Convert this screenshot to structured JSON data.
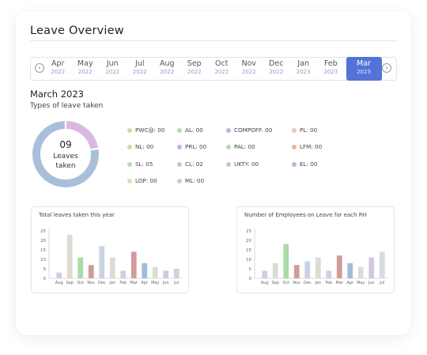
{
  "page": {
    "title": "Leave Overview"
  },
  "month_nav": {
    "prev_icon": "chevron-left-icon",
    "next_icon": "chevron-right-icon",
    "months": [
      {
        "month": "Apr",
        "year": "2022"
      },
      {
        "month": "May",
        "year": "2022"
      },
      {
        "month": "Jun",
        "year": "2022"
      },
      {
        "month": "Jul",
        "year": "2022"
      },
      {
        "month": "Aug",
        "year": "2022"
      },
      {
        "month": "Sep",
        "year": "2022"
      },
      {
        "month": "Oct",
        "year": "2022"
      },
      {
        "month": "Nov",
        "year": "2022"
      },
      {
        "month": "Dec",
        "year": "2022"
      },
      {
        "month": "Jan",
        "year": "2023"
      },
      {
        "month": "Feb",
        "year": "2023"
      },
      {
        "month": "Mar",
        "year": "2023"
      }
    ],
    "selected_index": 11,
    "accent": "#5472d8"
  },
  "summary": {
    "heading": "March 2023",
    "subheading": "Types of leave taken",
    "total": "09",
    "total_label_line1": "Leaves",
    "total_label_line2": "taken",
    "donut": {
      "segments": [
        {
          "label": "CL",
          "value": 2,
          "color": "#d9b8e3"
        },
        {
          "label": "other",
          "value": 7,
          "color": "#a9bfd9"
        }
      ]
    }
  },
  "legend": [
    {
      "text": "PWC@: 00",
      "color": "#e6cfb0"
    },
    {
      "text": "AL: 00",
      "color": "#b6ddb0"
    },
    {
      "text": "COMPOFF: 00",
      "color": "#a9bfd9"
    },
    {
      "text": "PL: 00",
      "color": "#ecc9b6"
    },
    {
      "text": "NL: 00",
      "color": "#e6cfb0"
    },
    {
      "text": "PRL: 00",
      "color": "#a9bfd9"
    },
    {
      "text": "PAL: 00",
      "color": "#b6ddb0"
    },
    {
      "text": "LFM: 00",
      "color": "#f0b39a"
    },
    {
      "text": "SL: 05",
      "color": "#b6ddb0"
    },
    {
      "text": "CL: 02",
      "color": "#d9b8e3"
    },
    {
      "text": "UKTY: 00",
      "color": "#d9b8e3"
    },
    {
      "text": "EL: 00",
      "color": "#a9bfd9"
    },
    {
      "text": "LOP: 00",
      "color": "#e6d8b8"
    },
    {
      "text": "ML: 00",
      "color": "#b6ddb0"
    }
  ],
  "chart_data": [
    {
      "type": "bar",
      "title": "Total leaves taken this year",
      "categories": [
        "Aug",
        "Sep",
        "Oct",
        "Nov",
        "Dec",
        "Jan",
        "Feb",
        "Mar",
        "Apr",
        "May",
        "Jun",
        "Jul"
      ],
      "values": [
        3,
        23,
        11,
        7,
        17,
        11,
        4,
        14,
        8,
        6,
        4,
        5
      ],
      "colors": [
        "#c8d3e3",
        "#dcdcd4",
        "#a9dca6",
        "#d19a9a",
        "#c8d3e3",
        "#dcdcd4",
        "#c8d3e3",
        "#d19a9a",
        "#9fbcd8",
        "#dcdcd4",
        "#d3c8e0",
        "#c8d3e3"
      ],
      "yticks": [
        "25",
        "20",
        "15",
        "10",
        "5",
        "0"
      ],
      "ylim": [
        0,
        25
      ]
    },
    {
      "type": "bar",
      "title": "Number of Employees on Leave for each RH",
      "categories": [
        "Aug",
        "Sep",
        "Oct",
        "Nov",
        "Dec",
        "Jan",
        "Feb",
        "Mar",
        "Apr",
        "May",
        "Jun",
        "Jul"
      ],
      "values": [
        4,
        8,
        18,
        7,
        9,
        11,
        4,
        12,
        8,
        6,
        11,
        14
      ],
      "colors": [
        "#c8d3e3",
        "#dcdcd4",
        "#a9dca6",
        "#d19a9a",
        "#c8d3e3",
        "#dcdcd4",
        "#c8d3e3",
        "#d19a9a",
        "#9fbcd8",
        "#dcdcd4",
        "#d3c8e0",
        "#d9dbe0"
      ],
      "yticks": [
        "25",
        "20",
        "15",
        "10",
        "5",
        "0"
      ],
      "ylim": [
        0,
        25
      ]
    }
  ]
}
